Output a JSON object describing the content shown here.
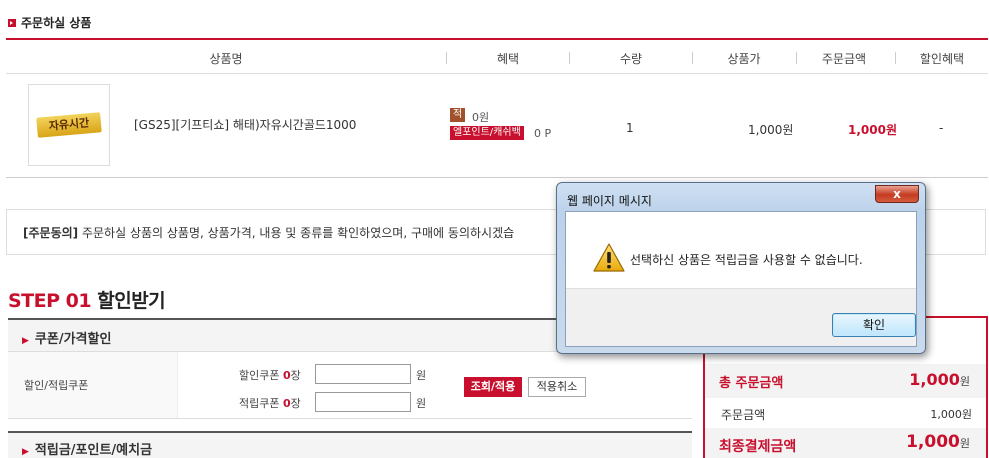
{
  "section": {
    "title": "주문하실 상품"
  },
  "table": {
    "headers": [
      "상품명",
      "혜택",
      "수량",
      "상품가",
      "주문금액",
      "할인혜택"
    ],
    "product": {
      "image_text": "자유시간",
      "name": "[GS25][기프티쇼] 해태)자유시간골드1000",
      "benefit1_badge": "적",
      "benefit1_value": "0원",
      "benefit2_badge": "엘포인트/캐쉬백",
      "benefit2_value": "0 P",
      "qty": "1",
      "price": "1,000원",
      "order_amount": "1,000원",
      "discount": "-"
    }
  },
  "agreement": {
    "label": "[주문동의]",
    "text": "주문하실 상품의 상품명, 상품가격, 내용 및 종류를 확인하였으며, 구매에 동의하시겠습"
  },
  "step": {
    "prefix": "STEP 01",
    "title": "할인받기"
  },
  "coupon": {
    "header": "쿠폰/가격할인",
    "row_label": "할인/적립쿠폰",
    "discount_label": "할인쿠폰",
    "discount_count": "0",
    "discount_unit": "장",
    "save_label": "적립쿠폰",
    "save_count": "0",
    "save_unit": "장",
    "won": "원",
    "apply_btn": "조회/적용",
    "cancel_btn": "적용취소"
  },
  "points": {
    "header": "적립금/포인트/예치금"
  },
  "summary": {
    "total_label": "총 주문금액",
    "total_value": "1,000",
    "order_label": "주문금액",
    "order_value": "1,000원",
    "final_label": "최종결제금액",
    "final_value": "1,000",
    "won": "원"
  },
  "dialog": {
    "title": "웹 페이지 메시지",
    "close": "x",
    "message": "선택하신 상품은 적립금을 사용할 수 없습니다.",
    "ok": "확인"
  },
  "colors": {
    "accent": "#c8102e"
  }
}
